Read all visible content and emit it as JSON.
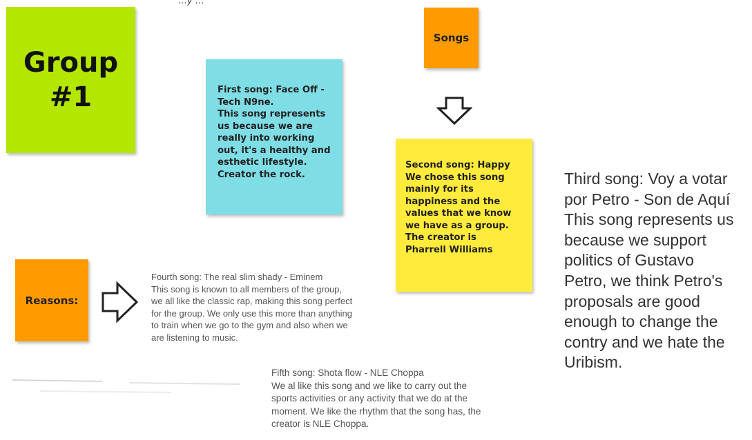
{
  "top_caption": "…y …",
  "group_label": "Group\n#1",
  "songs_label": "Songs",
  "reasons_label": "Reasons:",
  "first_song_note": "First song: Face Off  -\nTech N9ne.\nThis song represents\nus because we are\nreally into working\nout, it's a healthy and\nesthetic lifestyle.\nCreator the rock.",
  "second_song_note": "Second song: Happy\nWe chose this song\nmainly for its\nhappiness and the\nvalues that we know\nwe have as a group.\nThe creator is\nPharrell Williams",
  "third_song": "Third song: Voy a votar\npor Petro - Son de Aquí\nThis song represents us\nbecause we support\npolitics of Gustavo\nPetro, we think Petro's\nproposals are good\nenough to change the\ncontry and we hate the\nUribism.",
  "fourth_song": "Fourth song: The real slim shady - Eminem\nThis song is known to all members of the group,\nwe all like the classic rap, making this song perfect\nfor the group. We only use this more than anything\nto train when we go to the gym and also when we\nare listening to music.",
  "fifth_song": "Fifth song: Shota flow - NLE Choppa\nWe al like this song and we like to carry out the\nsports activities or any activity that we do at the\nmoment. We like the rhythm that the song has, the\ncreator is NLE Choppa.",
  "colors": {
    "group_note": "#b3e600",
    "orange_note": "#ff9a00",
    "blue_note": "#7fdde6",
    "yellow_note": "#ffeb3b"
  },
  "icons": {
    "down_arrow": "outlined-down-arrow-icon",
    "right_arrow": "outlined-right-arrow-icon"
  }
}
